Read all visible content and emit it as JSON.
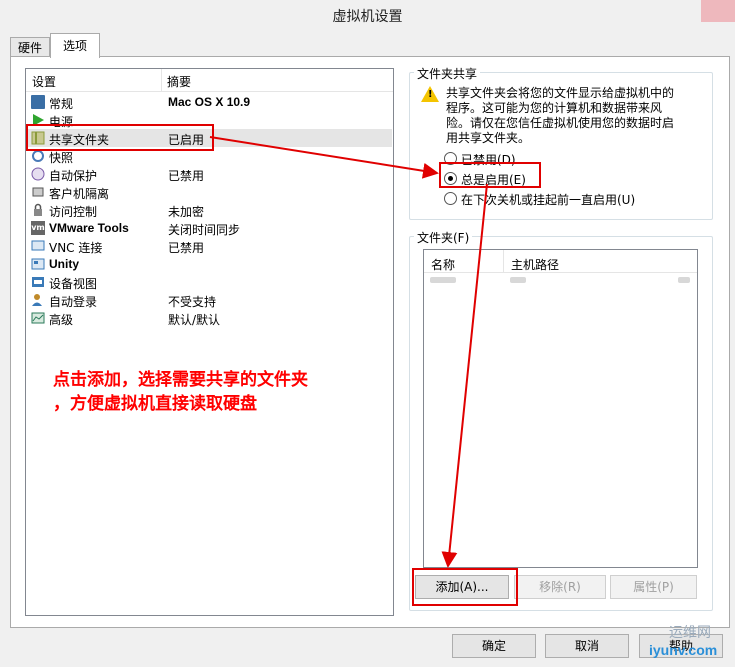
{
  "window": {
    "title": "虚拟机设置"
  },
  "tabs": [
    {
      "label": "硬件"
    },
    {
      "label": "选项"
    }
  ],
  "list": {
    "headers": {
      "setting": "设置",
      "summary": "摘要"
    },
    "items": [
      {
        "name": "常规",
        "summary": "Mac OS X 10.9",
        "icon": "monitor-icon",
        "color": "#3a6ea5"
      },
      {
        "name": "电源",
        "summary": "",
        "icon": "play-icon",
        "color": "#2fa52f"
      },
      {
        "name": "共享文件夹",
        "summary": "已启用",
        "icon": "folder-share-icon",
        "color": "#8a9a3a"
      },
      {
        "name": "快照",
        "summary": "",
        "icon": "snapshot-icon",
        "color": "#4a7ab8"
      },
      {
        "name": "自动保护",
        "summary": "已禁用",
        "icon": "autoprotect-icon",
        "color": "#7a5aa8"
      },
      {
        "name": "客户机隔离",
        "summary": "",
        "icon": "isolation-icon",
        "color": "#555555"
      },
      {
        "name": "访问控制",
        "summary": "未加密",
        "icon": "lock-icon",
        "color": "#555555"
      },
      {
        "name": "VMware Tools",
        "summary": "关闭时间同步",
        "icon": "vm-icon",
        "color": "#555555"
      },
      {
        "name": "VNC 连接",
        "summary": "已禁用",
        "icon": "vnc-icon",
        "color": "#3a7ab8"
      },
      {
        "name": "Unity",
        "summary": "",
        "icon": "unity-icon",
        "color": "#3a7ab8"
      },
      {
        "name": "设备视图",
        "summary": "",
        "icon": "device-view-icon",
        "color": "#3a7ab8"
      },
      {
        "name": "自动登录",
        "summary": "不受支持",
        "icon": "user-icon",
        "color": "#c08a2a"
      },
      {
        "name": "高级",
        "summary": "默认/默认",
        "icon": "advanced-icon",
        "color": "#2a7a5a"
      }
    ]
  },
  "share": {
    "label": "文件夹共享",
    "warning": "共享文件夹会将您的文件显示给虚拟机中的程序。这可能为您的计算机和数据带来风险。请仅在您信任虚拟机使用您的数据时启用共享文件夹。",
    "options": [
      {
        "label": "已禁用(D)",
        "checked": false
      },
      {
        "label": "总是启用(E)",
        "checked": true
      },
      {
        "label": "在下次关机或挂起前一直启用(U)",
        "checked": false
      }
    ]
  },
  "folders": {
    "label": "文件夹(F)",
    "headers": {
      "name": "名称",
      "path": "主机路径"
    },
    "add": "添加(A)...",
    "remove": "移除(R)",
    "properties": "属性(P)"
  },
  "footer": {
    "ok": "确定",
    "cancel": "取消",
    "help": "帮助"
  },
  "annotation": {
    "line1": "点击添加，选择需要共享的文件夹",
    "line2": "，方便虚拟机直接读取硬盘"
  },
  "watermark": {
    "line1": "运维网",
    "line2": "iyunv.com"
  },
  "colors": {
    "annotation": "#e00000",
    "warning": "#f4c400"
  }
}
